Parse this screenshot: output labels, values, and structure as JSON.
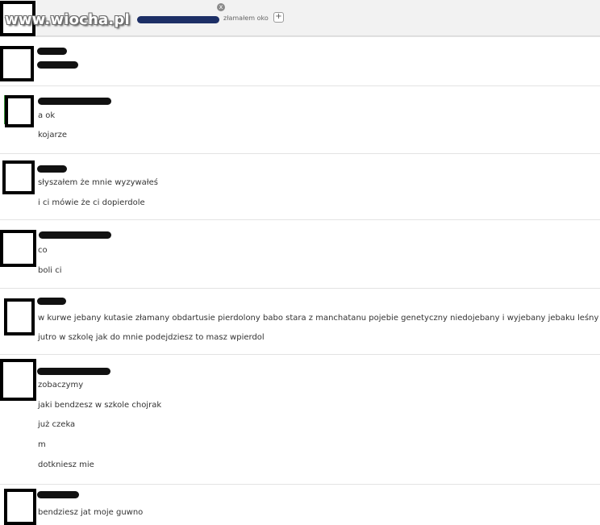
{
  "watermark": "www.wiocha.pl",
  "header": {
    "status": "złamałem oko",
    "close_icon": "close-icon",
    "add_icon": "plus-icon",
    "plus_glyph": "+",
    "close_glyph": "x"
  },
  "messages": [
    {
      "lines": []
    },
    {
      "lines": [
        "a ok",
        "kojarze"
      ]
    },
    {
      "lines": [
        "słyszałem że mnie wyzywałeś",
        "i ci mówie że ci dopierdole"
      ]
    },
    {
      "lines": [
        "co",
        "boli ci"
      ]
    },
    {
      "lines": [
        "w kurwe jebany kutasie złamany obdartusie pierdolony babo stara z manchatanu pojebie genetyczny niedojebany i wyjebany jebaku leśny",
        "jutro w szkolę jak do mnie podejdziesz to masz wpierdol"
      ]
    },
    {
      "lines": [
        "zobaczymy",
        "jaki bendzesz  w szkole chojrak",
        "już czeka",
        "m",
        "dotkniesz mie"
      ]
    },
    {
      "lines": [
        "bendziesz jat moje guwno"
      ]
    }
  ]
}
